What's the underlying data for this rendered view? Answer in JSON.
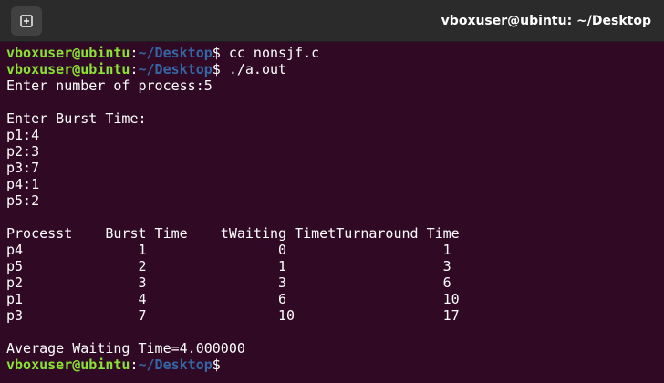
{
  "window": {
    "title": "vboxuser@ubintu: ~/Desktop",
    "new_tab_icon": "new-tab-icon"
  },
  "colors": {
    "background": "#300a24",
    "titlebar": "#2b2b2b",
    "prompt_user": "#8ae234",
    "prompt_path": "#3465a4",
    "text": "#ffffff"
  },
  "prompt": {
    "user": "vboxuser@ubintu",
    "separator": ":",
    "path": "~/Desktop",
    "symbol": "$"
  },
  "commands": [
    " cc nonsjf.c",
    " ./a.out"
  ],
  "output": [
    "Enter number of process:5",
    "",
    "Enter Burst Time:",
    "p1:4",
    "p2:3",
    "p3:7",
    "p4:1",
    "p5:2",
    "",
    "Processt    Burst Time    tWaiting TimetTurnaround Time",
    "p4              1                0                   1",
    "p5              2                1                   3",
    "p2              3                3                   6",
    "p1              4                6                   10",
    "p3              7                10                  17",
    "",
    "Average Waiting Time=4.000000"
  ],
  "table": {
    "headers": [
      "Processt",
      "Burst Time",
      "tWaiting Time",
      "tTurnaround Time"
    ],
    "rows": [
      [
        "p4",
        "1",
        "0",
        "1"
      ],
      [
        "p5",
        "2",
        "1",
        "3"
      ],
      [
        "p2",
        "3",
        "3",
        "6"
      ],
      [
        "p1",
        "4",
        "6",
        "10"
      ],
      [
        "p3",
        "7",
        "10",
        "17"
      ]
    ]
  },
  "summary": {
    "average_waiting_time": "4.000000"
  }
}
